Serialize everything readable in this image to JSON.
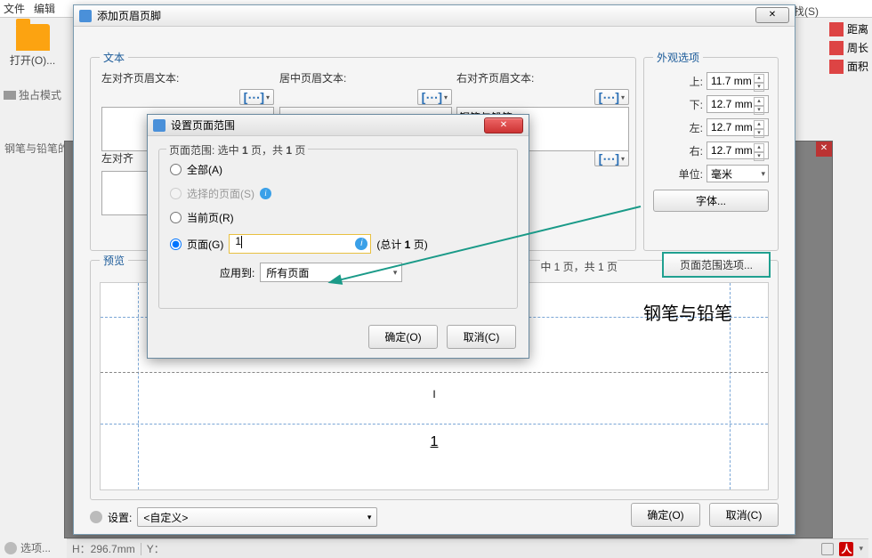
{
  "menubar": {
    "file": "文件",
    "edit": "编辑"
  },
  "adv_search": "高级查找(S)",
  "right_tools": {
    "distance": "距离",
    "perimeter": "周长",
    "area": "面积"
  },
  "left": {
    "open": "打开(O)...",
    "exclusive": "独占模式"
  },
  "bg_tab": "钢笔与铅笔的",
  "options": "选项...",
  "statusbar": {
    "h": "H：296.7mm",
    "y": "Y："
  },
  "main_dialog": {
    "title": "添加页眉页脚",
    "close": "✕",
    "gb_text": "文本",
    "gb_appear": "外观选项",
    "gb_preview": "预览",
    "cols": {
      "left_header": "左对齐页眉文本:",
      "center_header": "居中页眉文本:",
      "right_header": "右对齐页眉文本:",
      "right_header_val": "钢笔与铅笔",
      "left_footer": "左对齐"
    },
    "appear": {
      "top": "上:",
      "top_v": "11.7 mm",
      "bottom": "下:",
      "bottom_v": "12.7 mm",
      "left": "左:",
      "left_v": "12.7 mm",
      "right": "右:",
      "right_v": "12.7 mm",
      "unit": "单位:",
      "unit_v": "毫米",
      "font": "字体..."
    },
    "preview_info": "中 1 页，共 1 页",
    "preview_opts": "页面范围选项...",
    "preview_text": "钢笔与铅笔",
    "preview_mid": "I",
    "preview_pg": "1",
    "settings_label": "设置:",
    "settings_val": "<自定义>",
    "ok": "确定(O)",
    "cancel": "取消(C)"
  },
  "inner_dialog": {
    "title": "设置页面范围",
    "range_title_pre": "页面范围: 选中 ",
    "range_title_mid": " 页，共 ",
    "range_title_suf": " 页",
    "range_sel": "1",
    "range_total": "1",
    "r_all": "全部(A)",
    "r_selected": "选择的页面(S)",
    "r_current": "当前页(R)",
    "r_pages": "页面(G)",
    "page_val": "1",
    "total_pages_pre": "(总计 ",
    "total_pages_suf": " 页)",
    "total_pages": "1",
    "apply_to": "应用到:",
    "apply_val": "所有页面",
    "ok": "确定(O)",
    "cancel": "取消(C)"
  }
}
